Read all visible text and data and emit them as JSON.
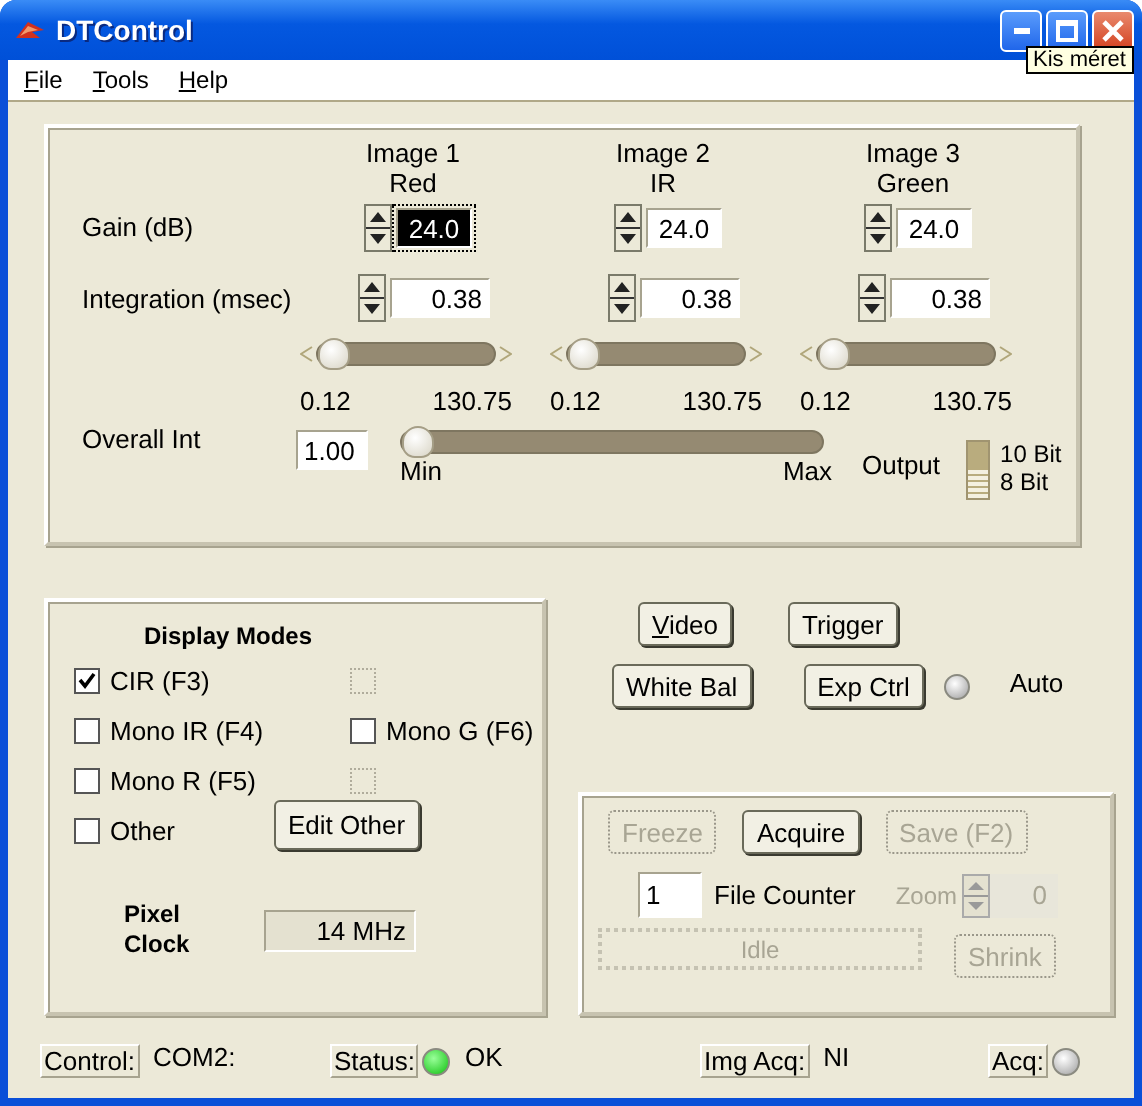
{
  "window": {
    "title": "DTControl",
    "tooltip": "Kis méret"
  },
  "menu": [
    {
      "label": "File"
    },
    {
      "label": "Tools"
    },
    {
      "label": "Help"
    }
  ],
  "image_columns": [
    {
      "title": "Image 1",
      "channel": "Red"
    },
    {
      "title": "Image 2",
      "channel": "IR"
    },
    {
      "title": "Image 3",
      "channel": "Green"
    }
  ],
  "gain": {
    "label": "Gain (dB)",
    "values": [
      {
        "value": "24.0",
        "selected": true
      },
      {
        "value": "24.0",
        "selected": false
      },
      {
        "value": "24.0",
        "selected": false
      }
    ]
  },
  "integration": {
    "label": "Integration (msec)",
    "values": [
      "0.38",
      "0.38",
      "0.38"
    ],
    "sliders": [
      {
        "level": 0,
        "min": "0.12",
        "max": "130.75"
      },
      {
        "level": 0,
        "min": "0.12",
        "max": "130.75"
      },
      {
        "level": 0,
        "min": "0.12",
        "max": "130.75"
      }
    ]
  },
  "overall": {
    "label": "Overall Int",
    "value": "1.00",
    "level": 0,
    "min": "Min",
    "max": "Max"
  },
  "output": {
    "label": "Output",
    "options": [
      {
        "label": "10 Bit",
        "selected": false
      },
      {
        "label": "8 Bit",
        "selected": true
      }
    ]
  },
  "display_modes": {
    "title": "Display Modes",
    "items": [
      {
        "kind": "checkbox",
        "label": "CIR (F3)",
        "checked": true,
        "disabled": false
      },
      {
        "kind": "checkbox",
        "checked": false,
        "disabled": true
      },
      {
        "kind": "checkbox",
        "label": "Mono IR (F4)",
        "checked": false,
        "disabled": false
      },
      {
        "kind": "checkbox",
        "label": "Mono G (F6)",
        "checked": false,
        "disabled": false
      },
      {
        "kind": "checkbox",
        "label": "Mono R (F5)",
        "checked": false,
        "disabled": false
      },
      {
        "kind": "checkbox",
        "checked": false,
        "disabled": true
      },
      {
        "kind": "checkbox",
        "label": "Other",
        "checked": false,
        "disabled": false
      },
      {
        "kind": "button",
        "label": "Edit Other"
      }
    ],
    "pixel_clock": {
      "label": "Pixel Clock",
      "value": "14 MHz"
    }
  },
  "controls": {
    "rows": [
      [
        {
          "label": "Video",
          "mnemonic": true
        },
        {
          "label": "Trigger",
          "mnemonic": false
        }
      ],
      [
        {
          "label": "White Bal",
          "mnemonic": false
        },
        {
          "label": "Exp Ctrl",
          "mnemonic": false
        }
      ]
    ],
    "auto": {
      "label": "Auto",
      "on": false
    }
  },
  "acquisition": {
    "buttons": [
      {
        "label": "Freeze",
        "disabled": true
      },
      {
        "label": "Acquire",
        "disabled": false
      },
      {
        "label": "Save (F2)",
        "disabled": true
      }
    ],
    "file_counter": {
      "value": "1",
      "label": "File Counter"
    },
    "zoom": {
      "label": "Zoom",
      "value": "0",
      "disabled": true
    },
    "status": {
      "text": "Idle",
      "disabled": true
    },
    "shrink": {
      "label": "Shrink",
      "disabled": true
    }
  },
  "status_bar": [
    {
      "label": "Control:",
      "value": "COM2:"
    },
    {
      "label": "Status:",
      "lit": true,
      "value": "OK"
    },
    {
      "label": "Img Acq:",
      "value": "NI"
    },
    {
      "label": "Acq:",
      "lit": false
    }
  ]
}
